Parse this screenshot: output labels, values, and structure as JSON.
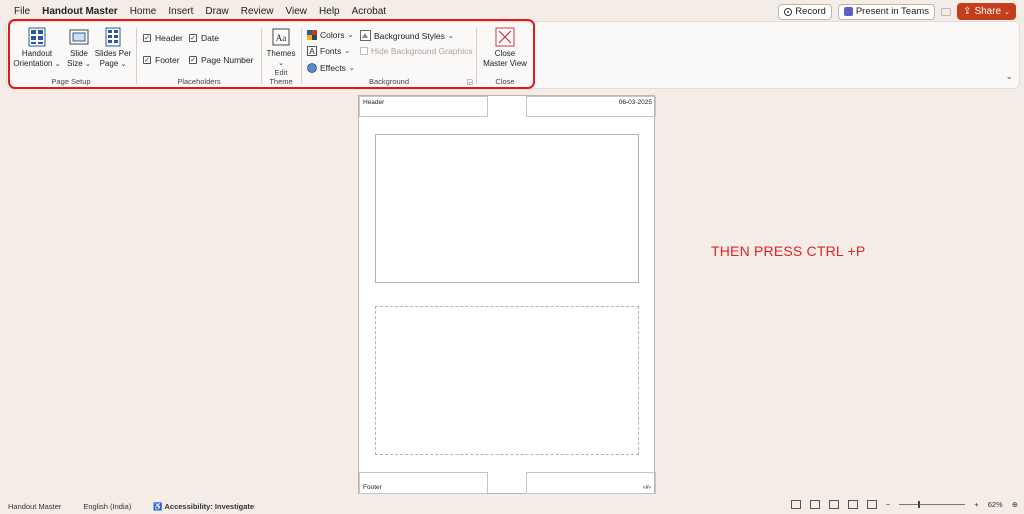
{
  "menu": {
    "tabs": [
      "File",
      "Handout Master",
      "Home",
      "Insert",
      "Draw",
      "Review",
      "View",
      "Help",
      "Acrobat"
    ],
    "active_tab": "Handout Master",
    "record_label": "Record",
    "present_teams_label": "Present in Teams",
    "share_label": "Share"
  },
  "ribbon": {
    "page_setup": {
      "label": "Page Setup",
      "handout_orientation": [
        "Handout",
        "Orientation"
      ],
      "slide_size": [
        "Slide",
        "Size"
      ],
      "slides_per_page": [
        "Slides Per",
        "Page"
      ]
    },
    "placeholders": {
      "label": "Placeholders",
      "header": "Header",
      "date": "Date",
      "footer": "Footer",
      "page_number": "Page Number"
    },
    "edit_theme": {
      "label": "Edit Theme",
      "themes": "Themes"
    },
    "background": {
      "label": "Background",
      "colors": "Colors",
      "fonts": "Fonts",
      "effects": "Effects",
      "background_styles": "Background Styles",
      "hide_background_graphics": "Hide Background Graphics"
    },
    "close": {
      "label": "Close",
      "close_master_view": [
        "Close",
        "Master View"
      ]
    }
  },
  "handout": {
    "header_text": "Header",
    "date_text": "06-03-2025",
    "footer_text": "Footer",
    "page_number_text": "‹#›"
  },
  "annotation": "THEN PRESS CTRL +P",
  "status": {
    "view_name": "Handout Master",
    "language": "English (India)",
    "accessibility": "Accessibility: Investigate",
    "zoom": "62%",
    "zoom_fraction": 0.3
  }
}
